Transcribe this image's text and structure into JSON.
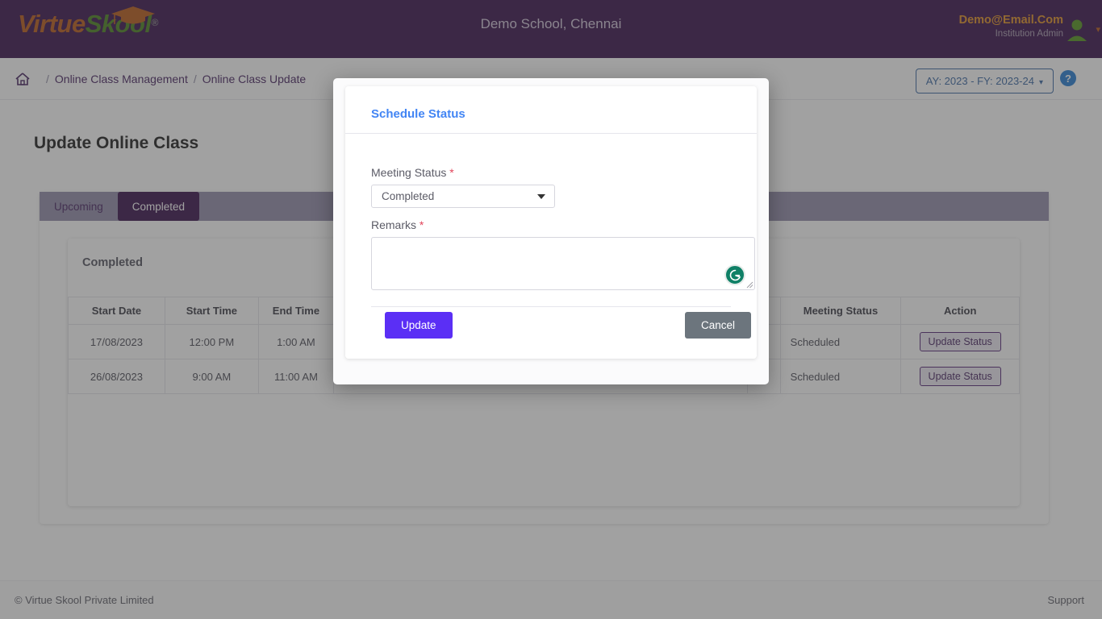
{
  "header": {
    "logo": {
      "part1": "Virtue",
      "part2": "Skool",
      "registered": "®",
      "icon": "graduation-cap-icon"
    },
    "school_name": "Demo School, Chennai",
    "user_email": "Demo@Email.Com",
    "user_role": "Institution Admin",
    "avatar_icon": "user-avatar-icon",
    "chevron_icon": "chevron-down-icon",
    "brand_purple": "#2d0442",
    "email_color": "#e08a18"
  },
  "breadcrumb": {
    "home_icon": "home-icon",
    "separator": "/",
    "items": [
      {
        "label": "Online Class Management"
      },
      {
        "label": "Online Class Update"
      }
    ]
  },
  "academic_year": {
    "label": "AY: 2023 - FY: 2023-24",
    "chevron": "⌄",
    "color": "#2f5f9e"
  },
  "help": {
    "label": "?",
    "icon": "help-circle-icon",
    "color": "#1976d2"
  },
  "main": {
    "page_title": "Update Online Class",
    "tabs": [
      {
        "label": "Upcoming",
        "active": false
      },
      {
        "label": "Completed",
        "active": true
      }
    ],
    "card_title": "Completed",
    "table": {
      "columns": [
        "Start Date",
        "Start Time",
        "End Time",
        "",
        "",
        "Meeting Status",
        "Action"
      ],
      "rows": [
        {
          "start_date": "17/08/2023",
          "start_time": "12:00 PM",
          "end_time": "1:00 AM",
          "col4": "",
          "col5": "",
          "meeting_status": "Scheduled",
          "action": "Update Status"
        },
        {
          "start_date": "26/08/2023",
          "start_time": "9:00 AM",
          "end_time": "11:00 AM",
          "col4": "",
          "col5": "",
          "meeting_status": "Scheduled",
          "action": "Update Status"
        }
      ]
    }
  },
  "modal": {
    "title": "Schedule Status",
    "meeting_status": {
      "label": "Meeting Status",
      "required": "*",
      "value": "Completed",
      "caret_icon": "caret-down-icon"
    },
    "remarks": {
      "label": "Remarks",
      "required": "*",
      "value": "",
      "placeholder": "",
      "grammarly_icon": "grammarly-g-icon",
      "resize_icon": "resize-handle-icon"
    },
    "buttons": {
      "update": "Update",
      "cancel": "Cancel"
    },
    "update_color": "#5b2ff5",
    "cancel_color": "#6c757d",
    "title_color": "#4285f4"
  },
  "footer": {
    "copyright": "© Virtue Skool Private Limited",
    "support": "Support"
  }
}
